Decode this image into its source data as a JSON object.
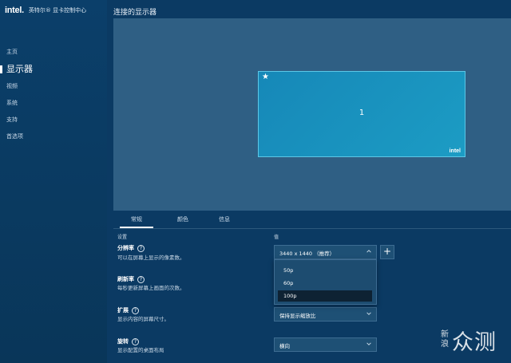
{
  "app": {
    "brand_logo": "intel.",
    "title": "英特尔® 显卡控制中心"
  },
  "sidebar": {
    "items": [
      {
        "label": "主页"
      },
      {
        "label": "显示器"
      },
      {
        "label": "视频"
      },
      {
        "label": "系统"
      },
      {
        "label": "支持"
      },
      {
        "label": "首选项"
      }
    ],
    "active_index": 1
  },
  "main": {
    "page_title": "连接的显示器",
    "monitor": {
      "number": "1",
      "primary_mark": "★",
      "logo": "intel"
    },
    "tabs": [
      {
        "label": "常规"
      },
      {
        "label": "颜色"
      },
      {
        "label": "信息"
      }
    ],
    "active_tab": 0,
    "columns": {
      "setting": "设置",
      "value": "值"
    },
    "settings": {
      "resolution": {
        "name": "分辨率",
        "desc": "可以在屏幕上显示的像素数。",
        "value": "3440 x 1440 （推荐）",
        "add_label": "+"
      },
      "refresh": {
        "name": "刷新率",
        "desc": "每秒更新屏幕上画面的次数。",
        "options": [
          "50p",
          "60p",
          "100p"
        ],
        "selected_index": 2
      },
      "scaling": {
        "name": "扩展",
        "desc": "显示内容的屏幕尺寸。",
        "value": "保持显示缩放比"
      },
      "rotation": {
        "name": "旋转",
        "desc": "显示配置的桌面布局",
        "value": "横向"
      }
    }
  },
  "watermark": {
    "small": "新浪",
    "big": "众测"
  },
  "colors": {
    "background": "#0b3a63",
    "canvas": "#2f5f84",
    "monitor": "#1a92c0",
    "dropdown_selected": "#0e2233"
  }
}
